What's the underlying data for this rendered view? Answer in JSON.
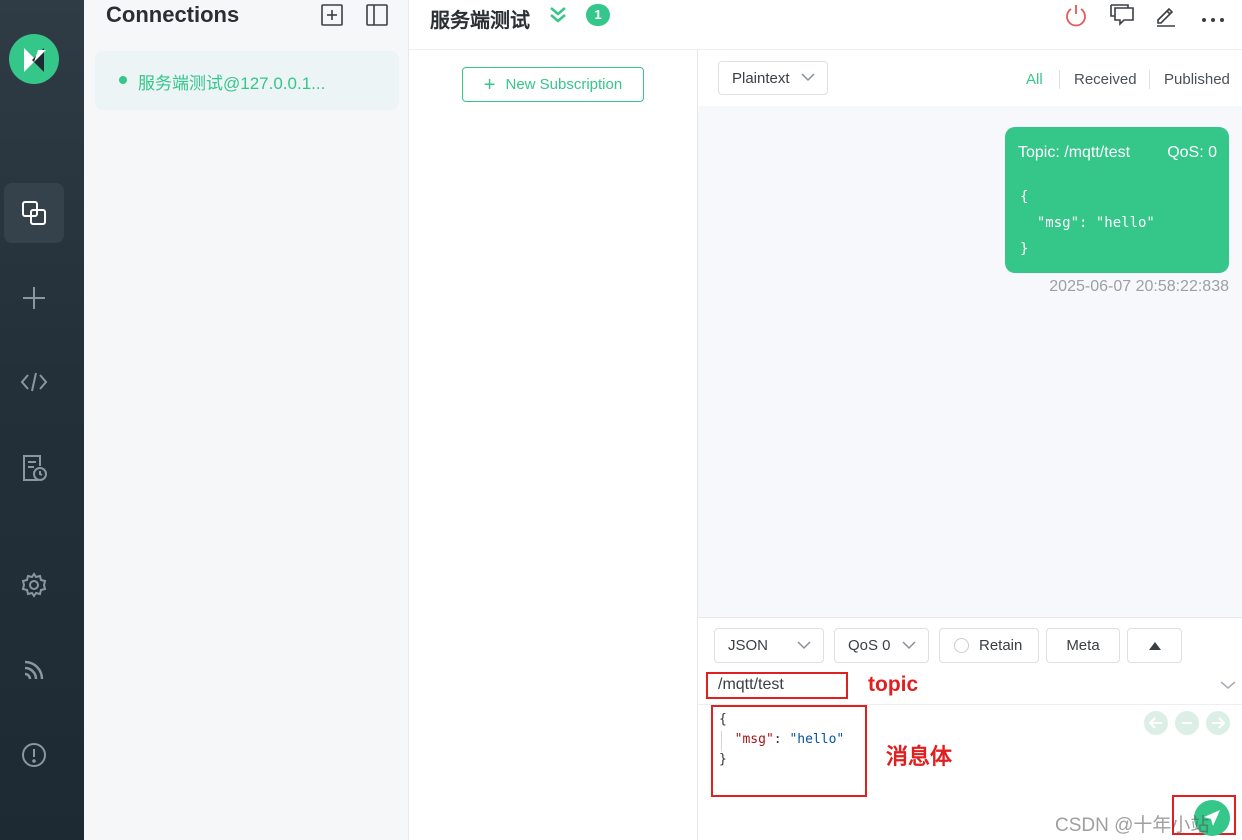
{
  "sidebar": {
    "nav": [
      "connections-icon",
      "plus-icon",
      "code-icon",
      "log-icon",
      "gear-icon",
      "feed-icon",
      "info-icon"
    ]
  },
  "connections": {
    "title": "Connections",
    "items": [
      {
        "name": "服务端测试@127.0.0.1...",
        "status_color": "#35c68a"
      }
    ]
  },
  "header": {
    "title": "服务端测试",
    "badge": "1"
  },
  "subscriptions": {
    "new_label": "New Subscription"
  },
  "messages": {
    "format": "Plaintext",
    "filters": [
      "All",
      "Received",
      "Published"
    ],
    "active_filter": "All",
    "items": [
      {
        "topic": "Topic: /mqtt/test",
        "qos": "QoS: 0",
        "payload": "{\n  \"msg\": \"hello\"\n}",
        "time": "2025-06-07 20:58:22:838"
      }
    ]
  },
  "publish": {
    "format": "JSON",
    "qos": "QoS 0",
    "retain_label": "Retain",
    "meta_label": "Meta",
    "topic_value": "/mqtt/test",
    "topic_note": "topic",
    "payload_open": "{",
    "payload_key": "\"msg\"",
    "payload_colon": ": ",
    "payload_value": "\"hello\"",
    "payload_close": "}",
    "body_note": "消息体"
  },
  "watermark": "CSDN @十年小站",
  "colors": {
    "accent": "#35c68a",
    "annotation": "#e02020",
    "sidebar_bg": "#2a3640"
  }
}
